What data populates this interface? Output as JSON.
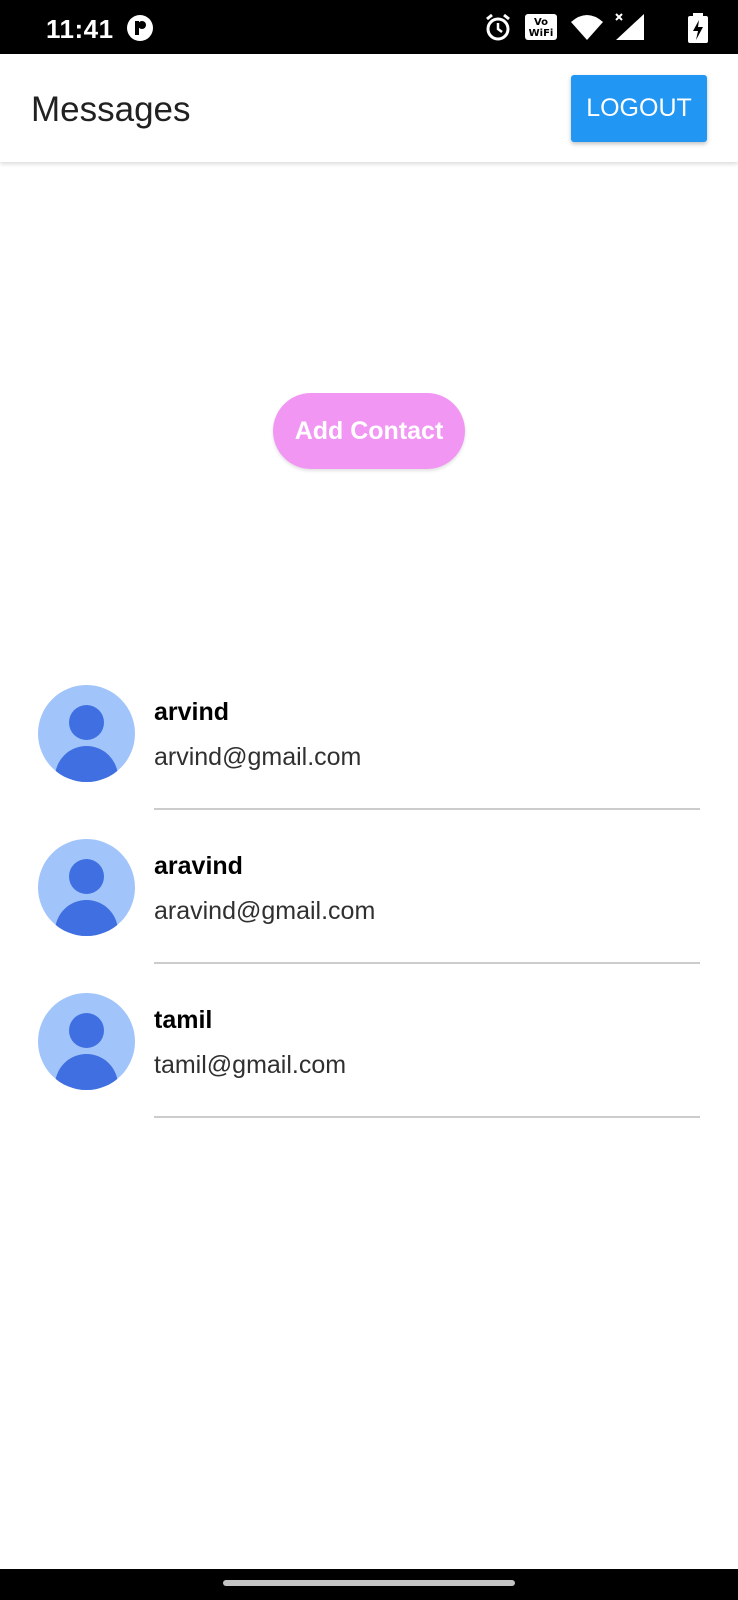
{
  "status_bar": {
    "time": "11:41",
    "app_icon": "notification-app-icon",
    "icons": [
      "alarm-icon",
      "vowifi-icon",
      "wifi-icon",
      "signal-icon",
      "battery-charging-icon"
    ],
    "vowifi_label_top": "Vo",
    "vowifi_label_bottom": "WiFi"
  },
  "app_bar": {
    "title": "Messages",
    "logout_label": "LOGOUT"
  },
  "add_contact": {
    "label": "Add Contact"
  },
  "contacts": [
    {
      "name": "arvind",
      "email": "arvind@gmail.com",
      "avatar_icon": "person-avatar-icon"
    },
    {
      "name": "aravind",
      "email": "aravind@gmail.com",
      "avatar_icon": "person-avatar-icon"
    },
    {
      "name": "tamil",
      "email": "tamil@gmail.com",
      "avatar_icon": "person-avatar-icon"
    }
  ],
  "colors": {
    "logout_bg": "#2196f3",
    "add_contact_bg": "#f197f3",
    "avatar_bg": "#a1c4fb",
    "avatar_fg": "#3f6fe0"
  }
}
